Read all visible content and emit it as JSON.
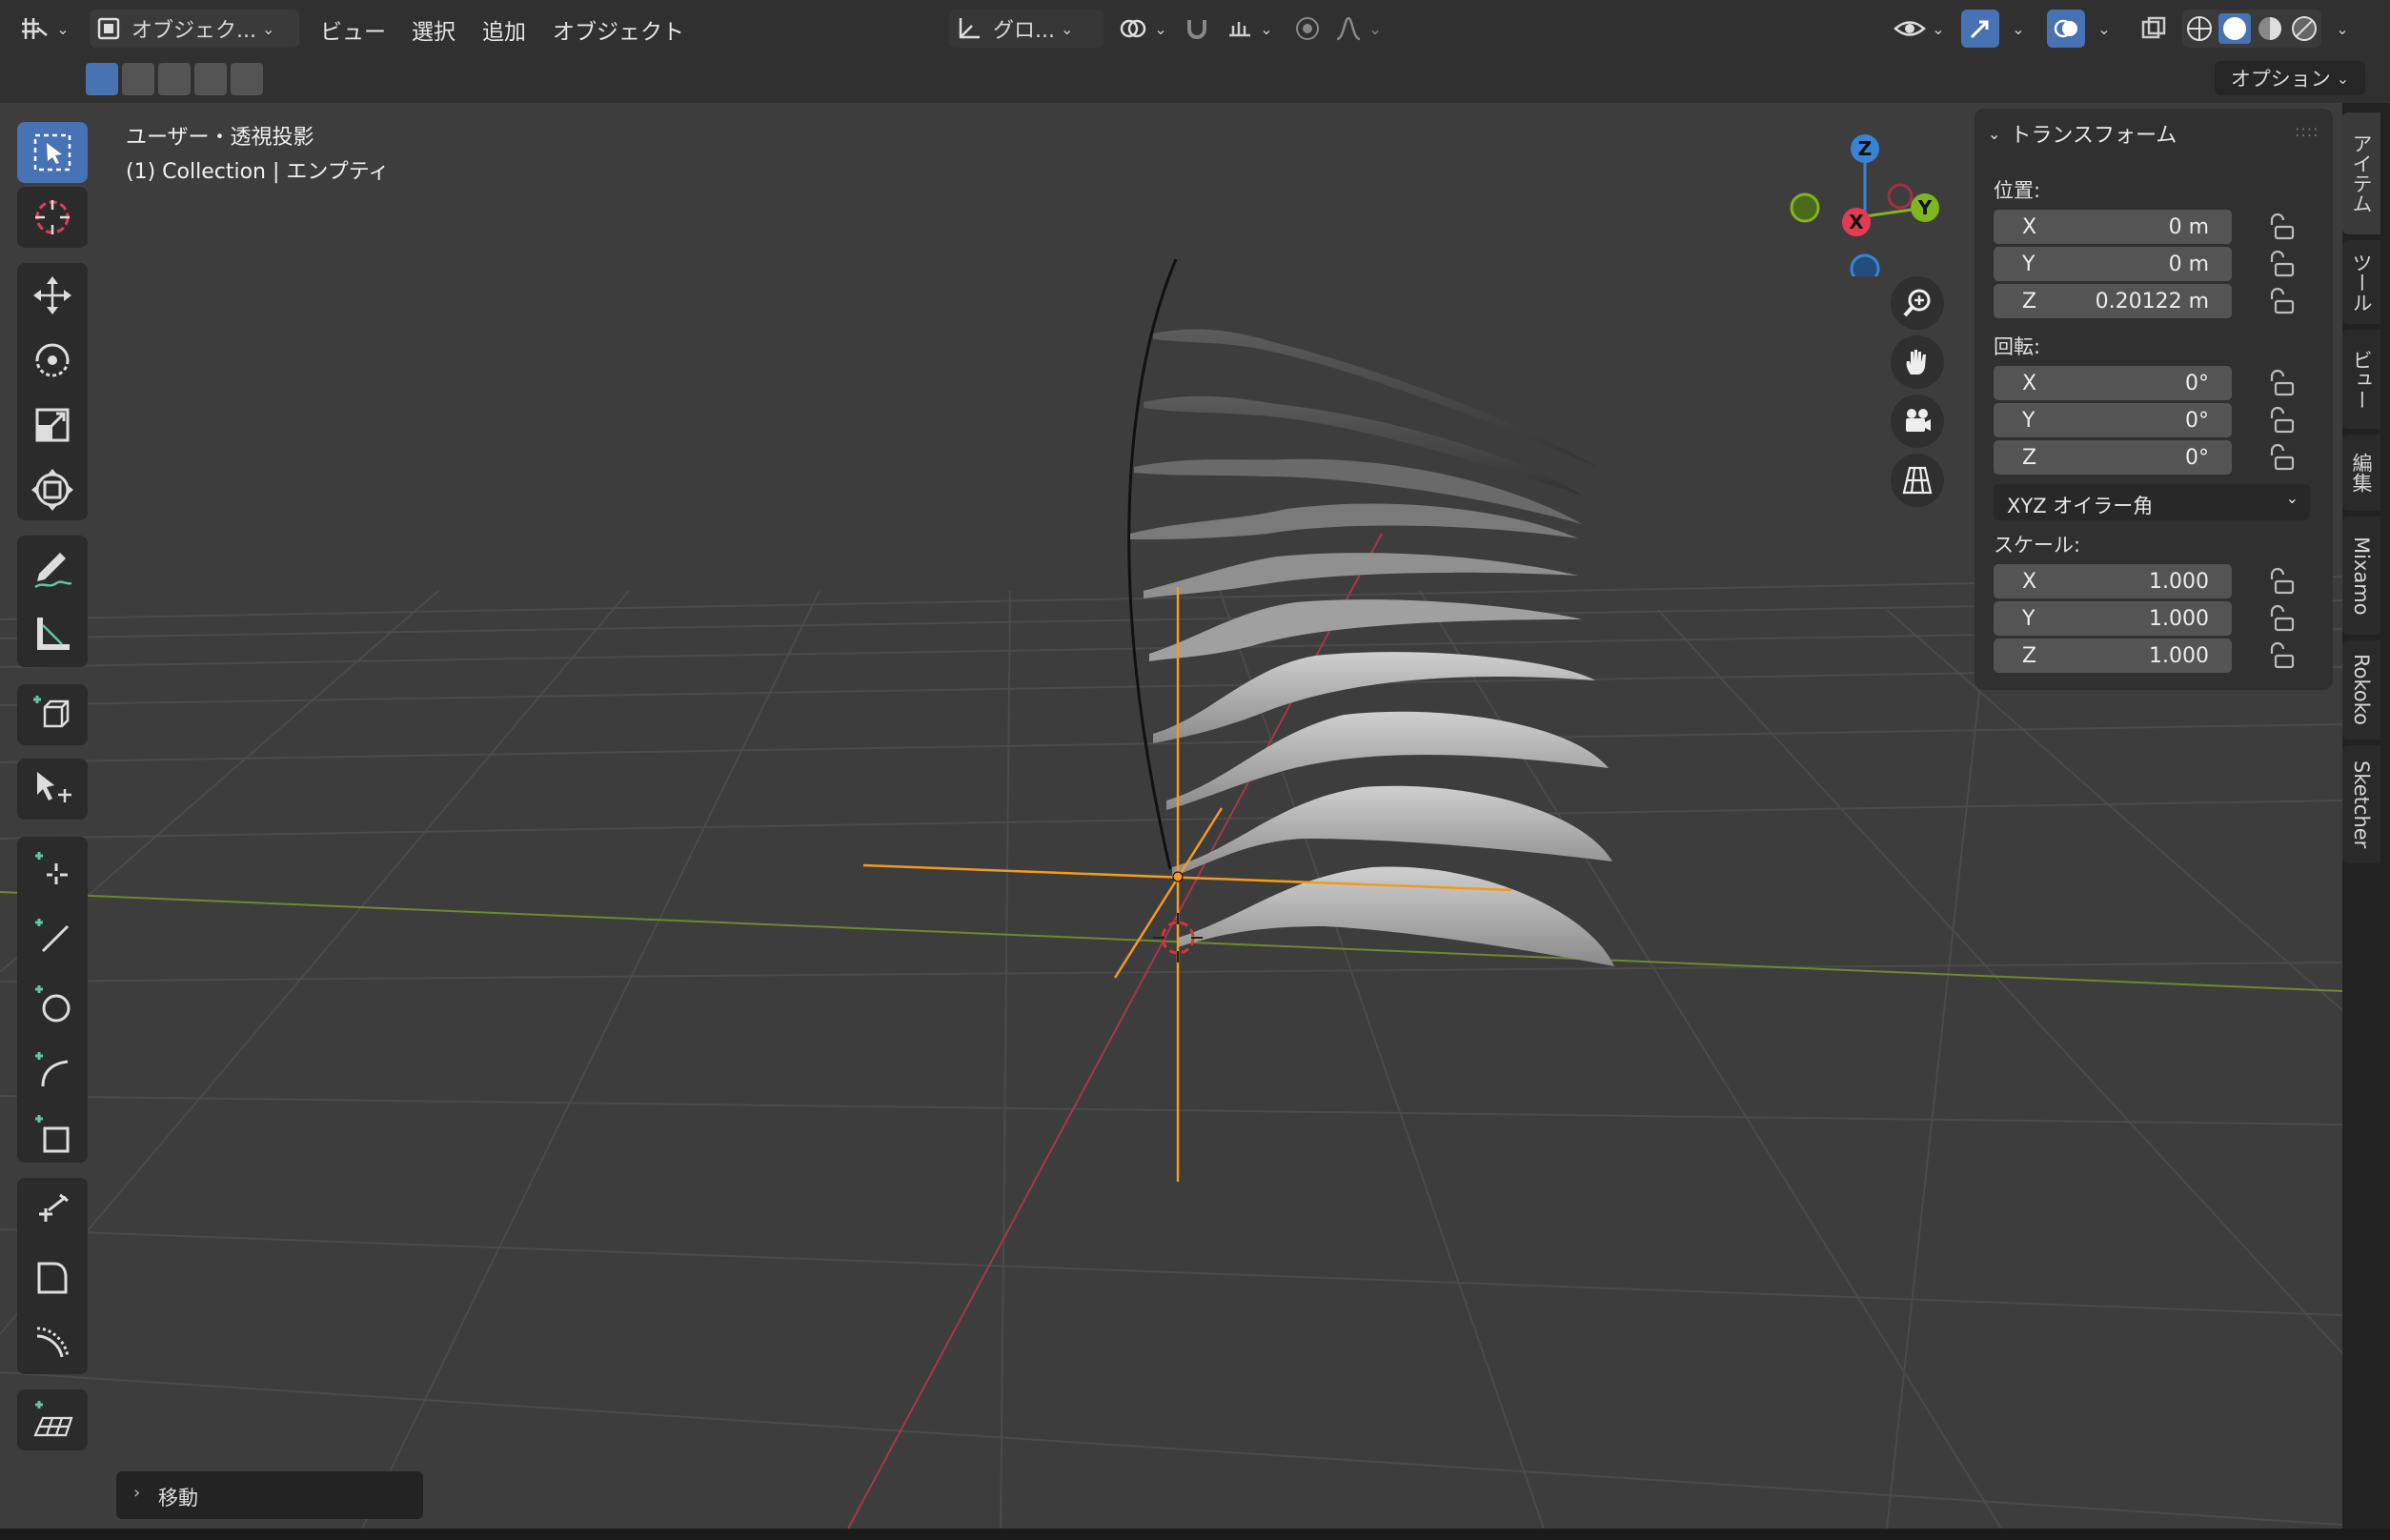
{
  "header": {
    "mode_label": "オブジェク...",
    "menus": [
      "ビュー",
      "選択",
      "追加",
      "オブジェクト"
    ],
    "transform_orientation": "グロ...",
    "options_label": "オプション"
  },
  "viewport": {
    "view_name": "ユーザー・透視投影",
    "object_info": "(1) Collection | エンプティ",
    "gizmo": {
      "z": "Z",
      "x": "X",
      "y": "Y"
    }
  },
  "sidebar": {
    "tabs": [
      "アイテム",
      "ツール",
      "ビュー",
      "編集",
      "Mixamo",
      "Rokoko",
      "Sketcher"
    ],
    "panel_title": "トランスフォーム",
    "location": {
      "label": "位置:",
      "fields": [
        {
          "axis": "X",
          "value": "0 m"
        },
        {
          "axis": "Y",
          "value": "0 m"
        },
        {
          "axis": "Z",
          "value": "0.20122 m"
        }
      ]
    },
    "rotation": {
      "label": "回転:",
      "fields": [
        {
          "axis": "X",
          "value": "0°"
        },
        {
          "axis": "Y",
          "value": "0°"
        },
        {
          "axis": "Z",
          "value": "0°"
        }
      ],
      "mode": "XYZ オイラー角"
    },
    "scale": {
      "label": "スケール:",
      "fields": [
        {
          "axis": "X",
          "value": "1.000"
        },
        {
          "axis": "Y",
          "value": "1.000"
        },
        {
          "axis": "Z",
          "value": "1.000"
        }
      ]
    }
  },
  "redo_panel": {
    "label": "移動"
  },
  "colors": {
    "accent": "#4772b3",
    "x_axis": "#e23b52",
    "y_axis": "#7fb51d",
    "z_axis": "#3a82d6",
    "origin": "#f39a1f"
  }
}
